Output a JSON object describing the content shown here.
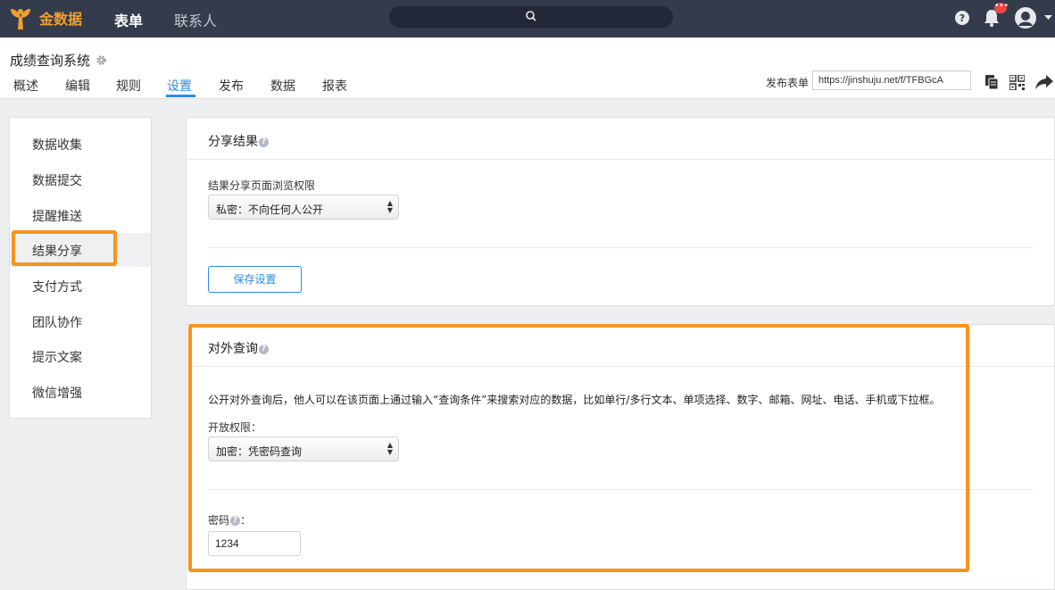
{
  "topbar": {
    "brand": "金数据",
    "nav": [
      "表单",
      "联系人"
    ],
    "notification_badge": "•••",
    "colors": {
      "bar": "#343b4b",
      "brand": "#f1a131",
      "badge": "#e84848"
    }
  },
  "form": {
    "title": "成绩查询系统",
    "tabs": [
      "概述",
      "编辑",
      "规则",
      "设置",
      "发布",
      "数据",
      "报表"
    ],
    "active_tab": "设置",
    "publish_label": "发布表单",
    "publish_url": "https://jinshuju.net/f/TFBGcA"
  },
  "sidebar": {
    "items": [
      {
        "label": "数据收集"
      },
      {
        "label": "数据提交"
      },
      {
        "label": "提醒推送"
      },
      {
        "label": "结果分享"
      },
      {
        "label": "支付方式"
      },
      {
        "label": "团队协作"
      },
      {
        "label": "提示文案"
      },
      {
        "label": "微信增强"
      }
    ],
    "active": "结果分享"
  },
  "share_panel": {
    "title": "分享结果",
    "field_label": "结果分享页面浏览权限",
    "select_value": "私密：不向任何人公开",
    "save_label": "保存设置"
  },
  "query_panel": {
    "title": "对外查询",
    "description": "公开对外查询后，他人可以在该页面上通过输入“查询条件”来搜索对应的数据，比如单行/多行文本、单项选择、数字、邮箱、网址、电话、手机或下拉框。",
    "permission_label": "开放权限：",
    "permission_value": "加密：凭密码查询",
    "password_label": "密码",
    "password_suffix": "：",
    "password_value": "1234"
  },
  "accent": {
    "link": "#2f8ae0",
    "highlight": "#f7941d"
  }
}
